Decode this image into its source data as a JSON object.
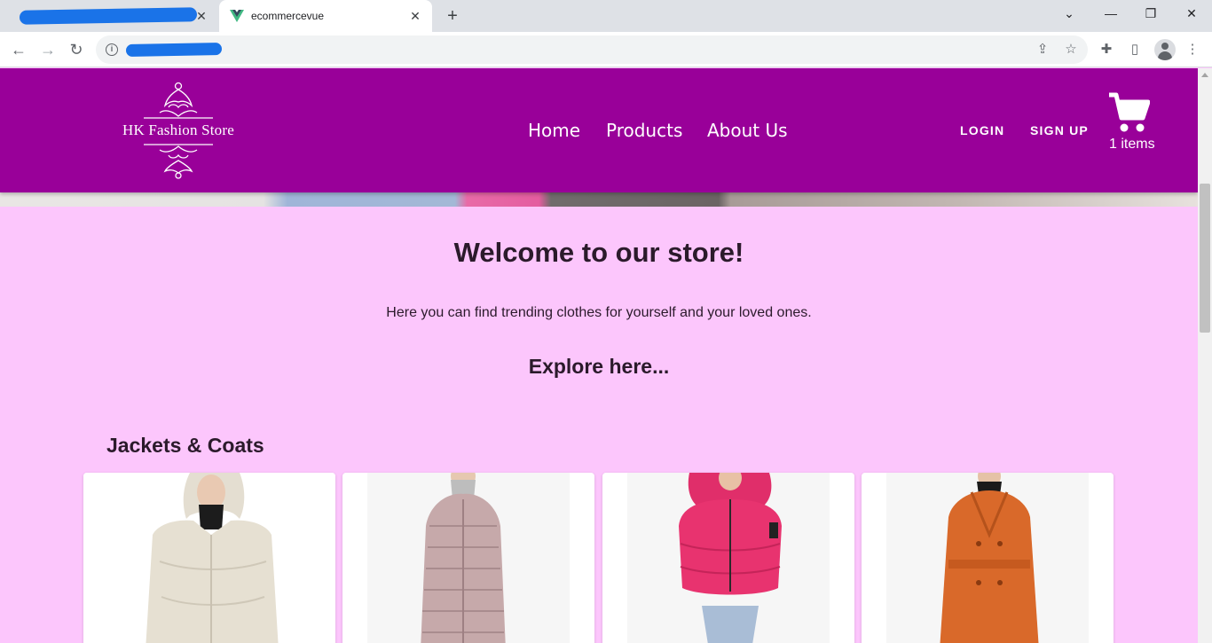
{
  "browser": {
    "tabs": [
      {
        "title": "",
        "redacted": true
      },
      {
        "title": "ecommercevue",
        "active": true
      }
    ],
    "close_glyph": "✕",
    "new_tab_glyph": "+",
    "window_controls": {
      "dropdown": "⌄",
      "minimize": "—",
      "restore": "❐",
      "close": "✕"
    },
    "url": "",
    "url_redacted": true,
    "icons": [
      "back-icon",
      "forward-icon",
      "reload-icon",
      "site-info-icon",
      "share-icon",
      "bookmark-star-icon",
      "extensions-icon",
      "side-panel-icon",
      "profile-icon",
      "menu-icon"
    ]
  },
  "site": {
    "logo_text": "HK Fashion Store",
    "nav": [
      {
        "label": "Home"
      },
      {
        "label": "Products"
      },
      {
        "label": "About Us"
      }
    ],
    "auth": {
      "login": "LOGIN",
      "signup": "SIGN UP"
    },
    "cart": {
      "count_label": "1 items",
      "icon": "cart-icon"
    },
    "colors": {
      "header": "#990099",
      "page_background": "#fcc6fc",
      "text": "#2b1a2b"
    }
  },
  "main": {
    "welcome": "Welcome to our store!",
    "subtext": "Here you can find trending clothes for yourself and your loved ones.",
    "explore": "Explore here...",
    "section": {
      "title": "Jackets & Coats",
      "products": [
        {
          "name": "cream-puffer-jacket",
          "color": "#e8e2d6"
        },
        {
          "name": "mauve-long-puffer-coat",
          "color": "#c9aeb0"
        },
        {
          "name": "pink-cropped-puffer",
          "color": "#e8336f"
        },
        {
          "name": "orange-long-wool-coat",
          "color": "#d96a2a"
        }
      ]
    }
  }
}
